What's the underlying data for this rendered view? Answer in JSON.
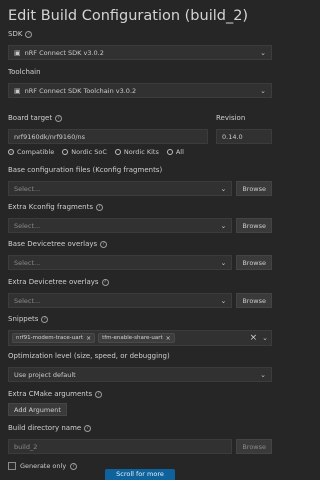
{
  "title": "Edit Build Configuration (build_2)",
  "sdk": {
    "label": "SDK",
    "value": "nRF Connect SDK v3.0.2"
  },
  "toolchain": {
    "label": "Toolchain",
    "value": "nRF Connect SDK Toolchain v3.0.2"
  },
  "board": {
    "label": "Board target",
    "value": "nrf9160dk/nrf9160/ns",
    "revision_label": "Revision",
    "revision_value": "0.14.0",
    "filters": [
      {
        "label": "Compatible",
        "selected": true
      },
      {
        "label": "Nordic SoC",
        "selected": false
      },
      {
        "label": "Nordic Kits",
        "selected": false
      },
      {
        "label": "All",
        "selected": false
      }
    ]
  },
  "base_config": {
    "label": "Base configuration files (Kconfig fragments)",
    "placeholder": "Select...",
    "browse": "Browse"
  },
  "extra_kconfig": {
    "label": "Extra Kconfig fragments",
    "placeholder": "Select...",
    "browse": "Browse"
  },
  "base_dt": {
    "label": "Base Devicetree overlays",
    "placeholder": "Select...",
    "browse": "Browse"
  },
  "extra_dt": {
    "label": "Extra Devicetree overlays",
    "placeholder": "Select...",
    "browse": "Browse"
  },
  "snippets": {
    "label": "Snippets",
    "chips": [
      "nrf91-modem-trace-uart",
      "tfm-enable-share-uart"
    ]
  },
  "optimization": {
    "label": "Optimization level (size, speed, or debugging)",
    "value": "Use project default"
  },
  "cmake": {
    "label": "Extra CMake arguments",
    "button": "Add Argument"
  },
  "build_dir": {
    "label": "Build directory name",
    "value": "build_2",
    "browse": "Browse"
  },
  "generate_only": {
    "label": "Generate only",
    "checked": false
  },
  "scroll_more": "Scroll for more"
}
